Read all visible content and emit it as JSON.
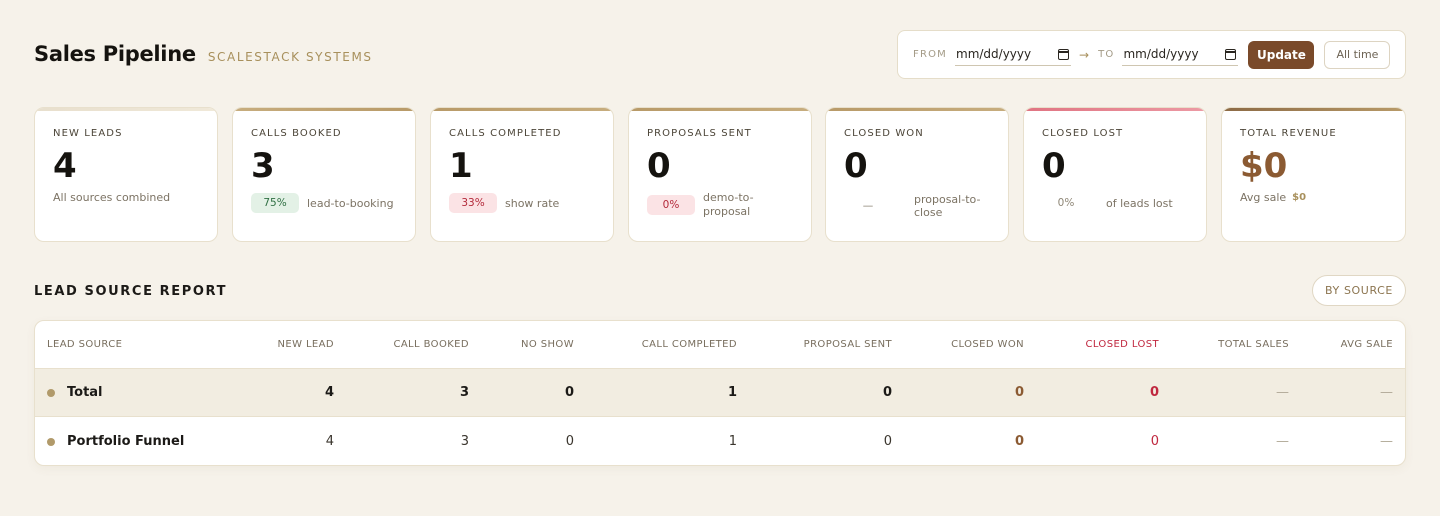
{
  "header": {
    "title": "Sales Pipeline",
    "subtitle": "SCALESTACK SYSTEMS"
  },
  "datebar": {
    "from_label": "FROM",
    "from_value": "mm/dd/yyyy",
    "to_label": "TO",
    "to_value": "mm/dd/yyyy",
    "update_label": "Update",
    "all_time_label": "All time",
    "arrow": "→"
  },
  "kpis": [
    {
      "label": "NEW LEADS",
      "value": "4",
      "sub": "All sources combined"
    },
    {
      "label": "CALLS BOOKED",
      "value": "3",
      "badge": "75%",
      "sub": "lead-to-booking"
    },
    {
      "label": "CALLS COMPLETED",
      "value": "1",
      "badge": "33%",
      "sub": "show rate"
    },
    {
      "label": "PROPOSALS SENT",
      "value": "0",
      "badge": "0%",
      "sub": "demo-to-proposal"
    },
    {
      "label": "CLOSED WON",
      "value": "0",
      "badge": "—",
      "sub": "proposal-to-close"
    },
    {
      "label": "CLOSED LOST",
      "value": "0",
      "badge": "0%",
      "sub": "of leads lost"
    },
    {
      "label": "TOTAL REVENUE",
      "value": "$0",
      "sub": "Avg sale",
      "sub_value": "$0"
    }
  ],
  "colors": {
    "accent_brown": "#7a4a2a",
    "gold": "#a8905c",
    "lost_red": "#c0283f"
  },
  "report": {
    "title": "LEAD SOURCE REPORT",
    "group_button": "BY SOURCE",
    "columns": [
      "LEAD SOURCE",
      "NEW LEAD",
      "CALL BOOKED",
      "NO SHOW",
      "CALL COMPLETED",
      "PROPOSAL SENT",
      "CLOSED WON",
      "CLOSED LOST",
      "TOTAL SALES",
      "AVG SALE"
    ],
    "rows": [
      {
        "name": "Total",
        "cells": [
          "4",
          "3",
          "0",
          "1",
          "0",
          "0",
          "0",
          "—",
          "—"
        ]
      },
      {
        "name": "Portfolio Funnel",
        "cells": [
          "4",
          "3",
          "0",
          "1",
          "0",
          "0",
          "0",
          "—",
          "—"
        ]
      }
    ]
  }
}
